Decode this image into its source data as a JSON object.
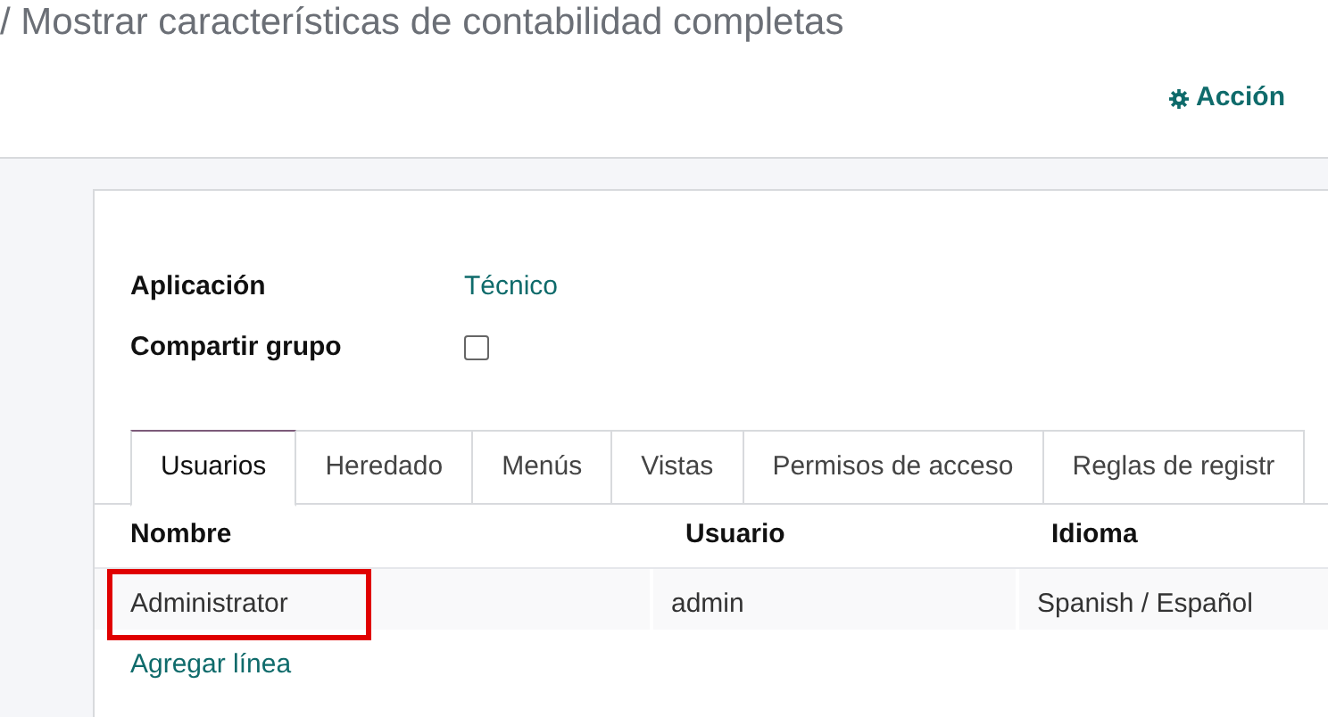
{
  "breadcrumb": "/ Mostrar características de contabilidad completas",
  "action_button": "Acción",
  "fields": [
    {
      "kind": "link",
      "label": "Aplicación",
      "value": "Técnico"
    },
    {
      "kind": "checkbox",
      "label": "Compartir grupo",
      "checked": false
    }
  ],
  "tabs": [
    {
      "label": "Usuarios",
      "selected": true
    },
    {
      "label": "Heredado",
      "selected": false
    },
    {
      "label": "Menús",
      "selected": false
    },
    {
      "label": "Vistas",
      "selected": false
    },
    {
      "label": "Permisos de acceso",
      "selected": false
    },
    {
      "label": "Reglas de registr",
      "selected": false
    }
  ],
  "table": {
    "columns": [
      "Nombre",
      "Usuario",
      "Idioma"
    ],
    "rows": [
      {
        "cells": [
          "Administrator",
          "admin",
          "Spanish / Español"
        ],
        "highlighted": true
      }
    ],
    "add_line": "Agregar línea"
  }
}
